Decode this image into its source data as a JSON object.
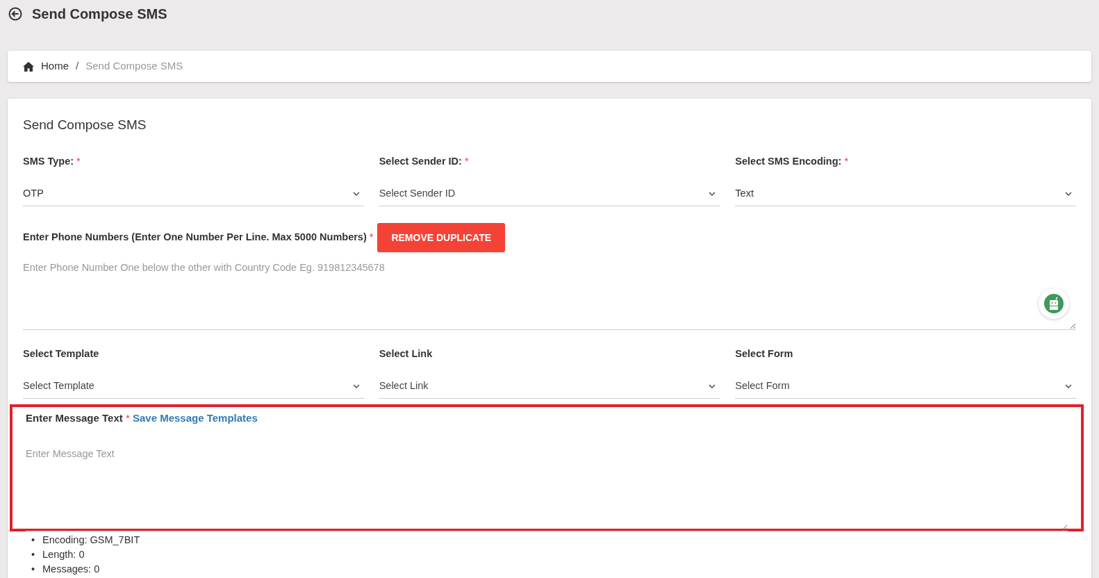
{
  "page_title": "Send Compose SMS",
  "breadcrumb": [
    {
      "label": "Home",
      "current": false
    },
    {
      "separator": "/",
      "label": "Send Compose SMS",
      "current": true
    }
  ],
  "card_title": "Send Compose SMS",
  "top_selects": [
    {
      "label": "SMS Type:",
      "required_mark": "*",
      "value": "OTP",
      "is_placeholder": false
    },
    {
      "label": "Select Sender ID:",
      "required_mark": "*",
      "value": "Select Sender ID",
      "is_placeholder": true
    },
    {
      "label": "Select SMS Encoding:",
      "required_mark": "*",
      "value": "Text",
      "is_placeholder": false
    }
  ],
  "phone_numbers": {
    "label": "Enter Phone Numbers (Enter One Number Per Line. Max 5000 Numbers)",
    "required_mark": "*",
    "button": "REMOVE DUPLICATE",
    "placeholder": "Enter Phone Number One below the other with Country Code Eg. 919812345678"
  },
  "extra_selects": [
    {
      "label": "Select Template",
      "value": "Select Template",
      "is_placeholder": true
    },
    {
      "label": "Select Link",
      "value": "Select Link",
      "is_placeholder": true
    },
    {
      "label": "Select Form",
      "value": "Select Form",
      "is_placeholder": true
    }
  ],
  "message": {
    "label": "Enter Message Text",
    "required_mark": "*",
    "link": "Save Message Templates",
    "placeholder": "Enter Message Text",
    "highlighted": true
  },
  "stats": [
    {
      "bullet": "•",
      "text": "Encoding: GSM_7BIT"
    },
    {
      "bullet": "•",
      "text": "Length: 0"
    },
    {
      "bullet": "•",
      "text": "Messages: 0"
    }
  ]
}
